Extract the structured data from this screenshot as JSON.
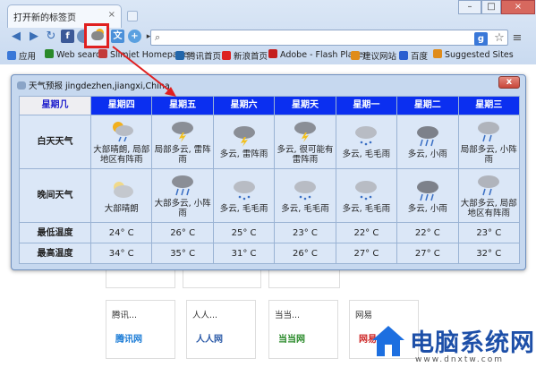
{
  "browser": {
    "tab_title": "打开新的标签页",
    "close_glyph": "×",
    "window_controls": [
      "–",
      "□",
      "×"
    ],
    "address_placeholder": "",
    "bookmarks": [
      {
        "label": "应用",
        "color": "#3a78d8"
      },
      {
        "label": "Web search",
        "color": "#2a8a2a"
      },
      {
        "label": "Slimjet Homepage",
        "color": "#c23b3b"
      },
      {
        "label": "腾讯首页",
        "color": "#2266aa"
      },
      {
        "label": "新浪首页",
        "color": "#d22"
      },
      {
        "label": "Adobe - Flash Player",
        "color": "#c41e1e"
      },
      {
        "label": "建议网站",
        "color": "#e08c1a"
      },
      {
        "label": "百度",
        "color": "#2a5fd0"
      },
      {
        "label": "Suggested Sites",
        "color": "#e08c1a"
      }
    ]
  },
  "popup": {
    "title": "天气预报 jingdezhen,jiangxi,China",
    "close_glyph": "x",
    "header_first": "星期几",
    "days": [
      "星期四",
      "星期五",
      "星期六",
      "星期天",
      "星期一",
      "星期二",
      "星期三"
    ],
    "rows": {
      "day_weather_label": "白天天气",
      "night_weather_label": "晚间天气",
      "min_temp_label": "最低温度",
      "max_temp_label": "最高温度"
    },
    "day_weather": [
      "大部晴朗, 局部地区有阵雨",
      "局部多云, 雷阵雨",
      "多云, 雷阵雨",
      "多云, 很可能有雷阵雨",
      "多云, 毛毛雨",
      "多云, 小雨",
      "局部多云, 小阵雨"
    ],
    "day_icons": [
      "sun-cloud-rain",
      "thunderstorm",
      "thunderstorm",
      "thunderstorm",
      "drizzle",
      "rain",
      "rain"
    ],
    "night_weather": [
      "大部晴朗",
      "大部多云, 小阵雨",
      "多云, 毛毛雨",
      "多云, 毛毛雨",
      "多云, 毛毛雨",
      "多云, 小雨",
      "大部多云, 局部地区有阵雨"
    ],
    "night_icons": [
      "partly-cloudy",
      "rain",
      "drizzle",
      "drizzle",
      "drizzle",
      "rain",
      "rain"
    ],
    "min_temps": [
      "24° C",
      "26° C",
      "25° C",
      "23° C",
      "22° C",
      "22° C",
      "23° C"
    ],
    "max_temps": [
      "34° C",
      "35° C",
      "31° C",
      "26° C",
      "27° C",
      "27° C",
      "32° C"
    ]
  },
  "tiles": [
    {
      "label": "腾讯...",
      "logo": "腾讯网",
      "color": "#1a7bd6"
    },
    {
      "label": "人人...",
      "logo": "人人网",
      "color": "#2b5aa8"
    },
    {
      "label": "当当...",
      "logo": "当当网",
      "color": "#2a8a2a"
    },
    {
      "label": "网易",
      "logo": "网易",
      "color": "#c22"
    }
  ],
  "watermark": {
    "text": "电脑系统网",
    "url": "www.dnxtw.com"
  }
}
